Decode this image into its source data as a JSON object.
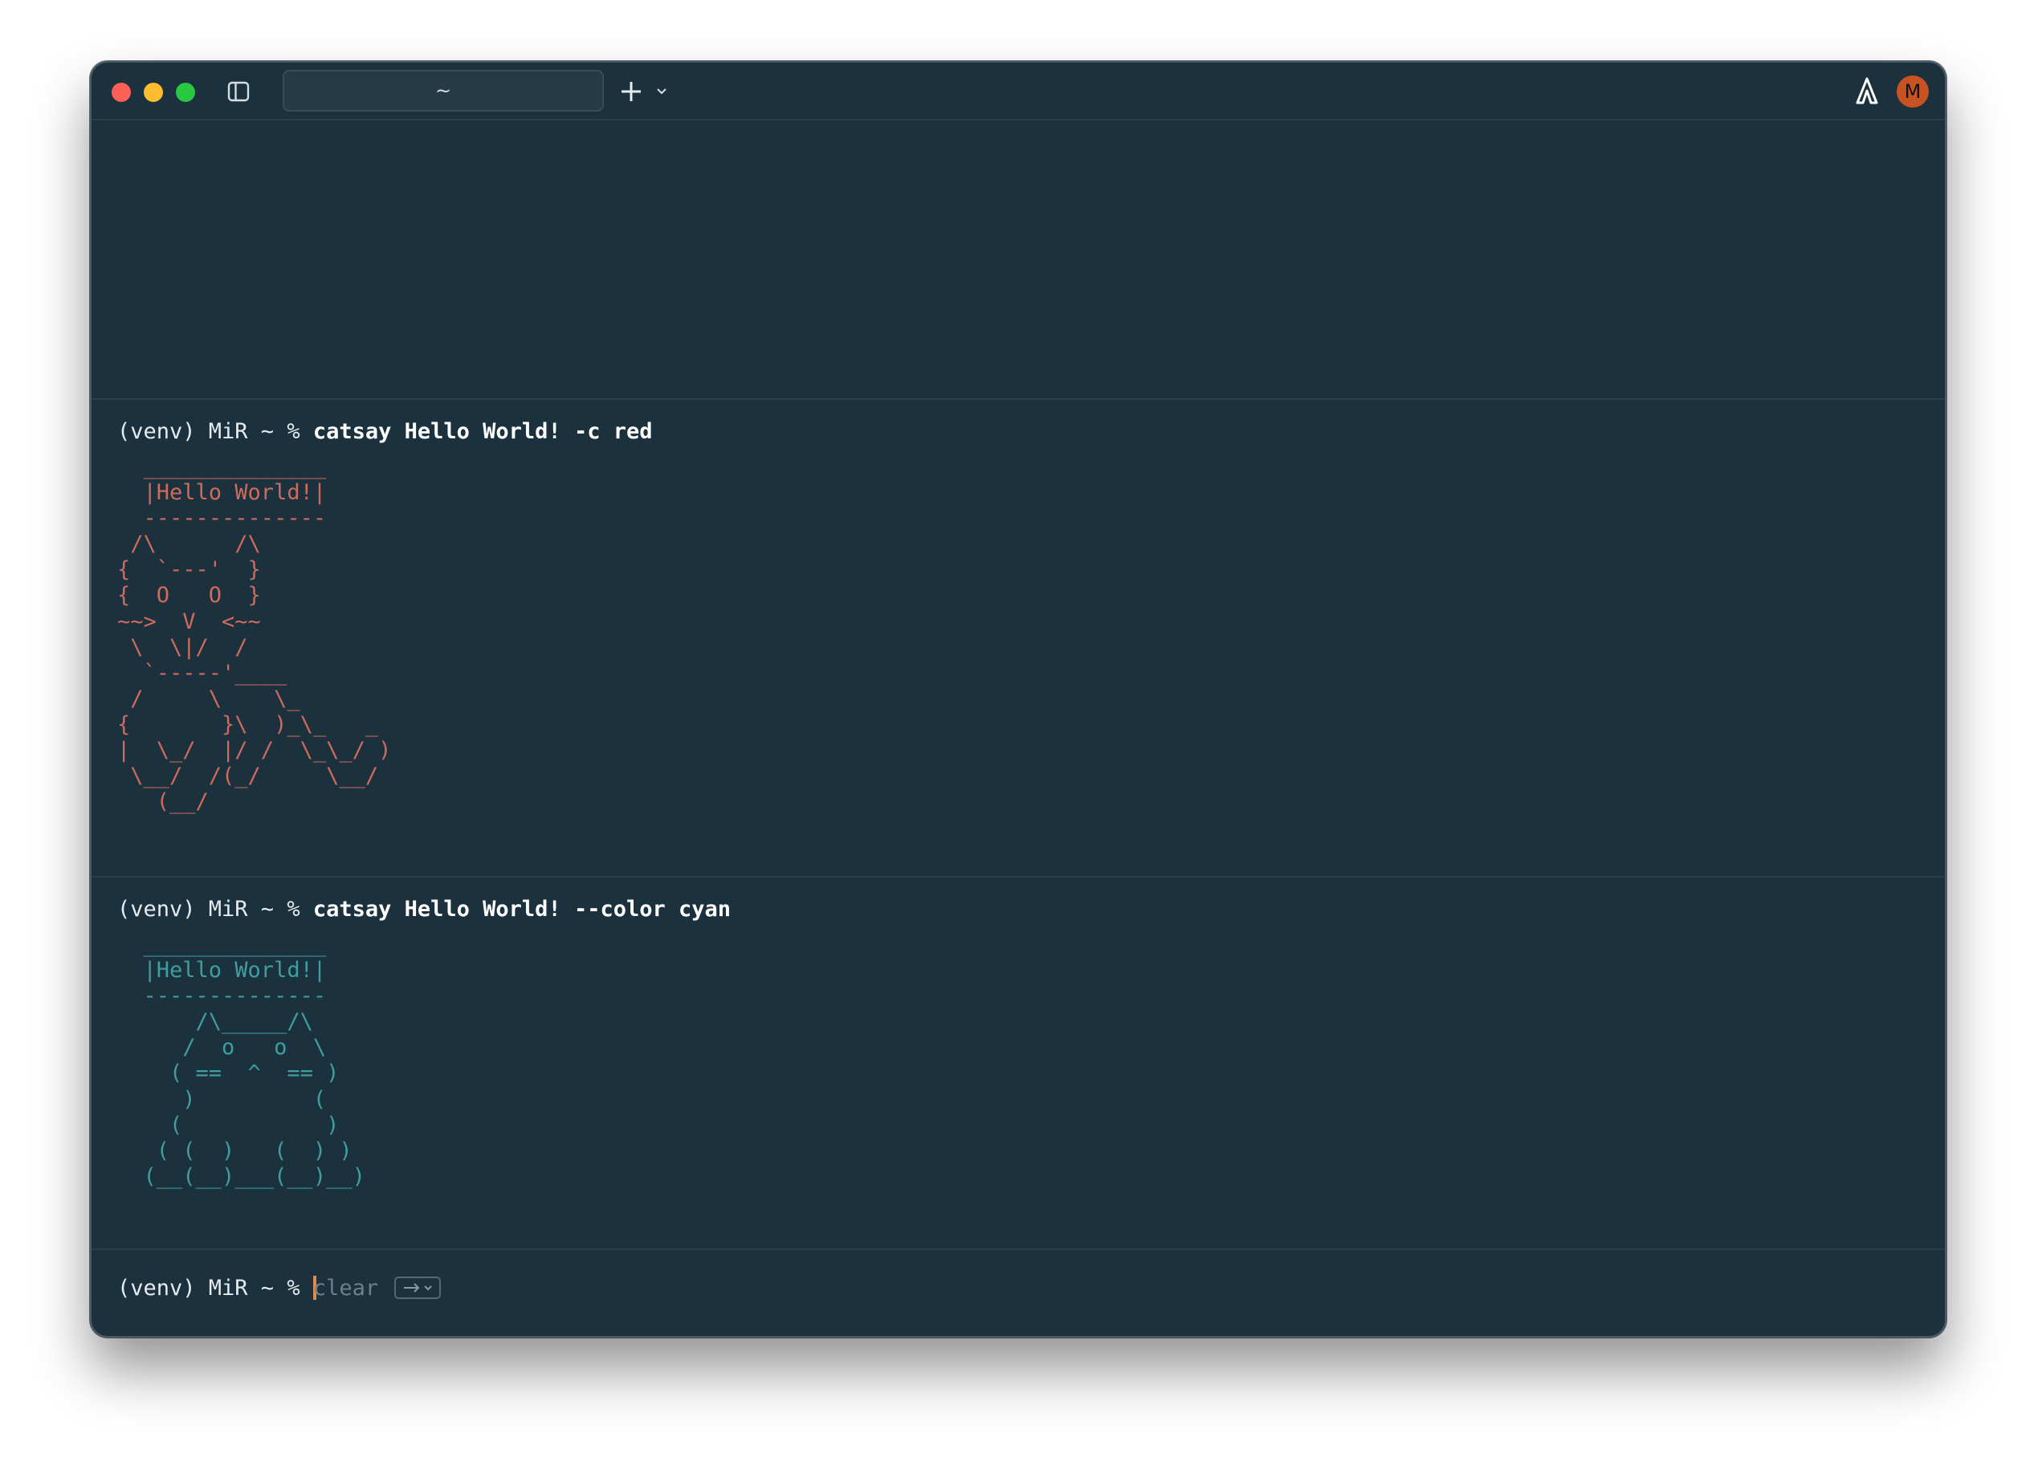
{
  "tab": {
    "title": "~"
  },
  "avatar": {
    "initial": "M"
  },
  "colors": {
    "background": "#1b313e",
    "red": "#d06a5c",
    "cyan": "#3f9ea0",
    "accent": "#c75323",
    "traffic_close": "#fe5f57",
    "traffic_minimize": "#febc2e",
    "traffic_zoom": "#28c840"
  },
  "icons": {
    "sidebar_toggle": "sidebar-icon",
    "new_tab": "plus-icon",
    "tab_menu": "chevron-down-icon",
    "brand": "warp-logo-icon",
    "hint": "arrow-right-icon"
  },
  "blocks": [
    {
      "prompt": "(venv) MiR ~ % ",
      "command": "catsay Hello World! -c red",
      "output": "  ______________\n  |Hello World!|\n  --------------\n /\\      /\\\n{  `---'  }\n{  O   O  }\n~~>  V  <~~\n \\  \\|/  /\n  `-----'____\n /     \\    \\_\n{       }\\  )_\\_   _\n|  \\_/  |/ /  \\_\\_/ )\n \\__/  /(_/     \\__/\n   (__/"
    },
    {
      "prompt": "(venv) MiR ~ % ",
      "command": "catsay Hello World! --color cyan",
      "output": "  ______________\n  |Hello World!|\n  --------------\n      /\\_____/\\\n     /  o   o  \\\n    ( ==  ^  == )\n     )         (\n    (           )\n   ( (  )   (  ) )\n  (__(__)___(__)__)"
    }
  ],
  "input": {
    "prompt": "(venv) MiR ~ % ",
    "suggestion": "clear"
  }
}
